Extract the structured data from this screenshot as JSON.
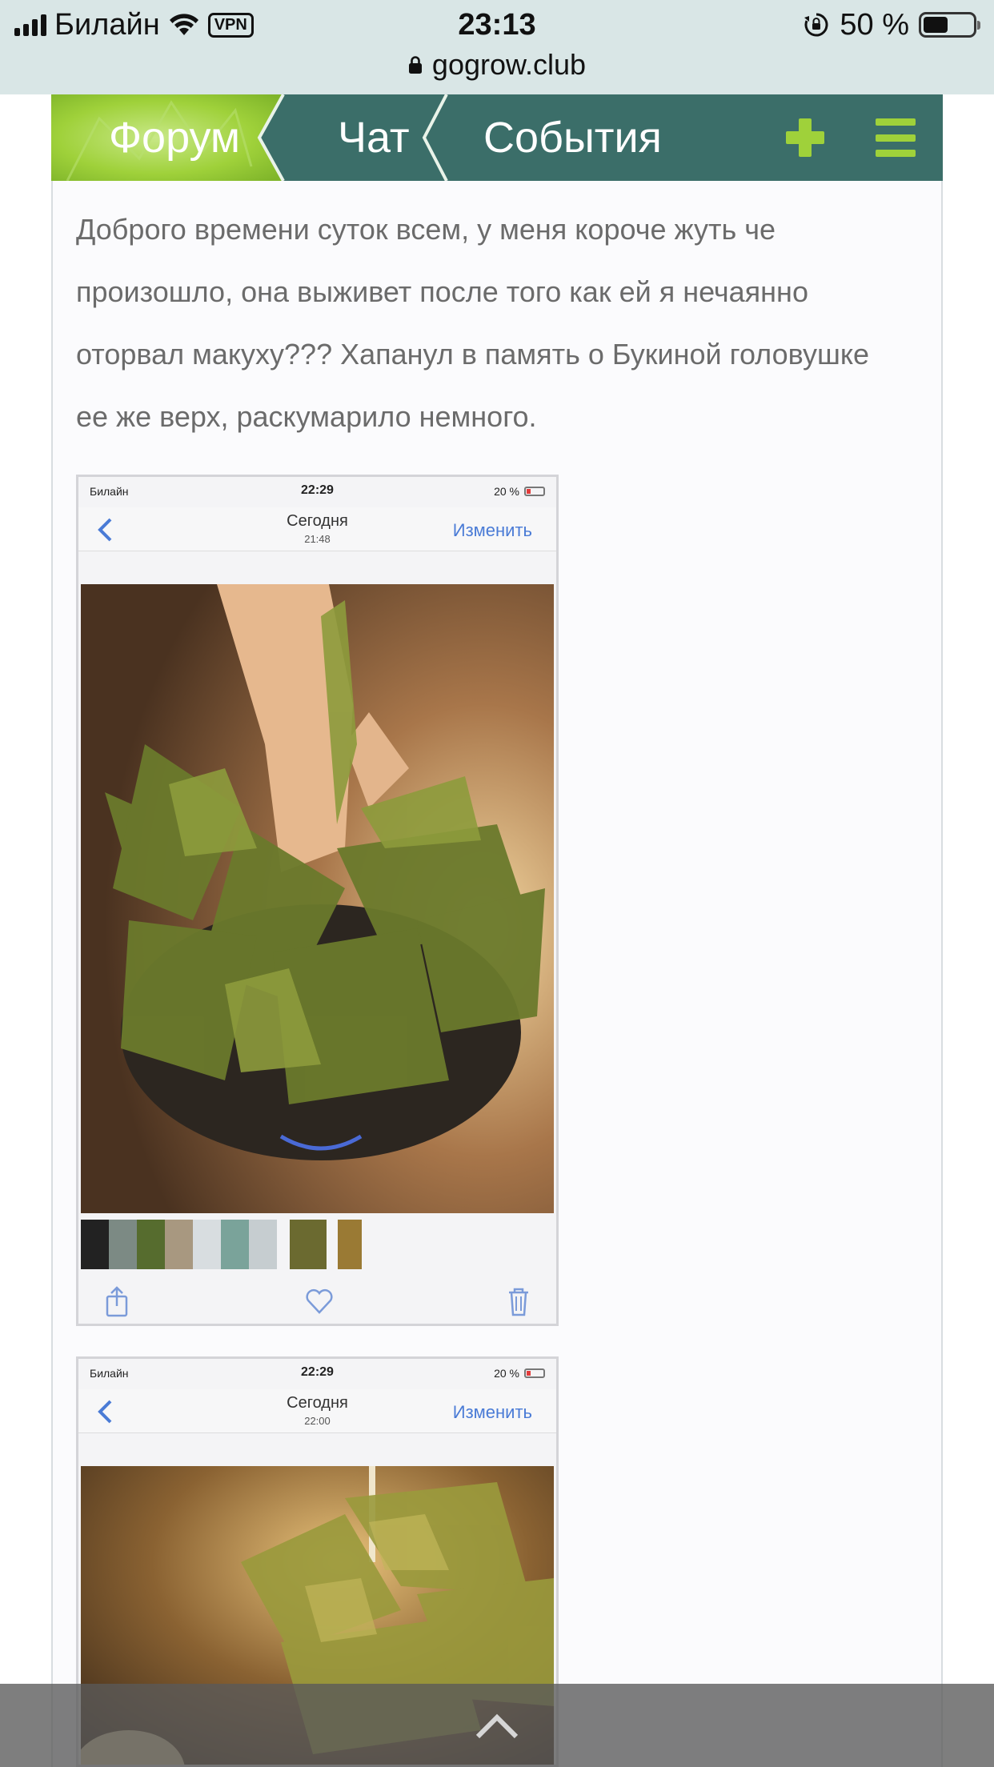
{
  "status_bar": {
    "carrier": "Билайн",
    "vpn": "VPN",
    "time": "23:13",
    "battery_percent": "50 %",
    "battery_level": 0.5
  },
  "browser": {
    "url": "gogrow.club"
  },
  "nav": {
    "tabs": [
      {
        "label": "Форум",
        "active": true
      },
      {
        "label": "Чат",
        "active": false
      },
      {
        "label": "События",
        "active": false
      }
    ],
    "accent_color": "#9fd13a",
    "bar_color": "#3b6e69",
    "icons": [
      "plus-icon",
      "menu-icon"
    ]
  },
  "post": {
    "text": "Доброго времени суток всем, у меня короче жуть че произошло, она выживет после того как ей я нечаянно оторвал макуху??? Хапанул  в память о Букиной головушке ее же верх, раскумарило немного."
  },
  "attachments": [
    {
      "status_carrier": "Билайн",
      "status_time": "22:29",
      "status_battery": "20 %",
      "title": "Сегодня",
      "subtitle": "21:48",
      "edit_label": "Изменить"
    },
    {
      "status_carrier": "Билайн",
      "status_time": "22:29",
      "status_battery": "20 %",
      "title": "Сегодня",
      "subtitle": "22:00",
      "edit_label": "Изменить"
    }
  ]
}
